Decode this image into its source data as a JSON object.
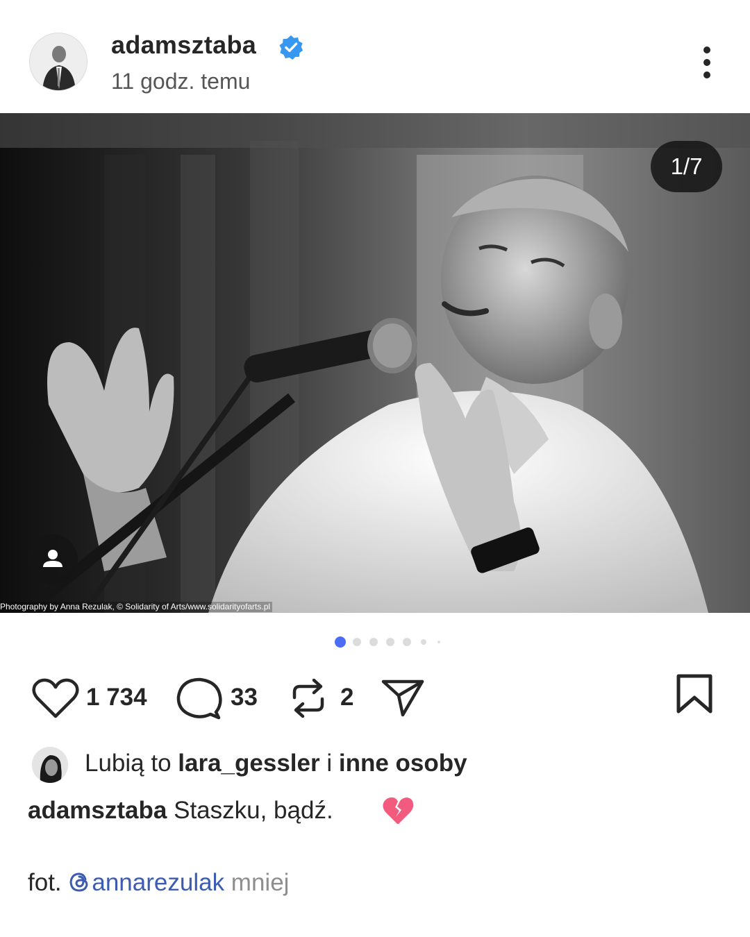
{
  "post": {
    "username": "adamsztaba",
    "time_ago": "11 godz. temu",
    "avatar_icon": "user-avatar",
    "verified_icon": "verified-badge-icon",
    "verified_color": "#3897f0",
    "more_icon": "more-vertical-icon"
  },
  "photo": {
    "counter": "1/7",
    "credit": "Photography by Anna Rezulak, © Solidarity of Arts/www.solidarityofarts.pl",
    "tag_icon": "person-tag-icon",
    "carousel_total": 7,
    "carousel_active": 1,
    "active_dot_color": "#4a6cf7"
  },
  "actions": {
    "likes_count": "1 734",
    "comments_count": "33",
    "reposts_count": "2",
    "like_icon": "heart-icon",
    "comment_icon": "comment-icon",
    "repost_icon": "repost-icon",
    "share_icon": "send-icon",
    "save_icon": "bookmark-icon"
  },
  "liked_by": {
    "prefix": "Lubią to ",
    "user": "lara_gessler",
    "middle": " i ",
    "others": "inne osoby"
  },
  "caption": {
    "username": "adamsztaba",
    "text": " Staszku, bądź. ",
    "emoji": "broken-heart-emoji"
  },
  "photo_credit_line": {
    "prefix": "fot. ",
    "mention": "annarezulak",
    "mention_icon": "threads-icon",
    "less_label": " mniej"
  }
}
